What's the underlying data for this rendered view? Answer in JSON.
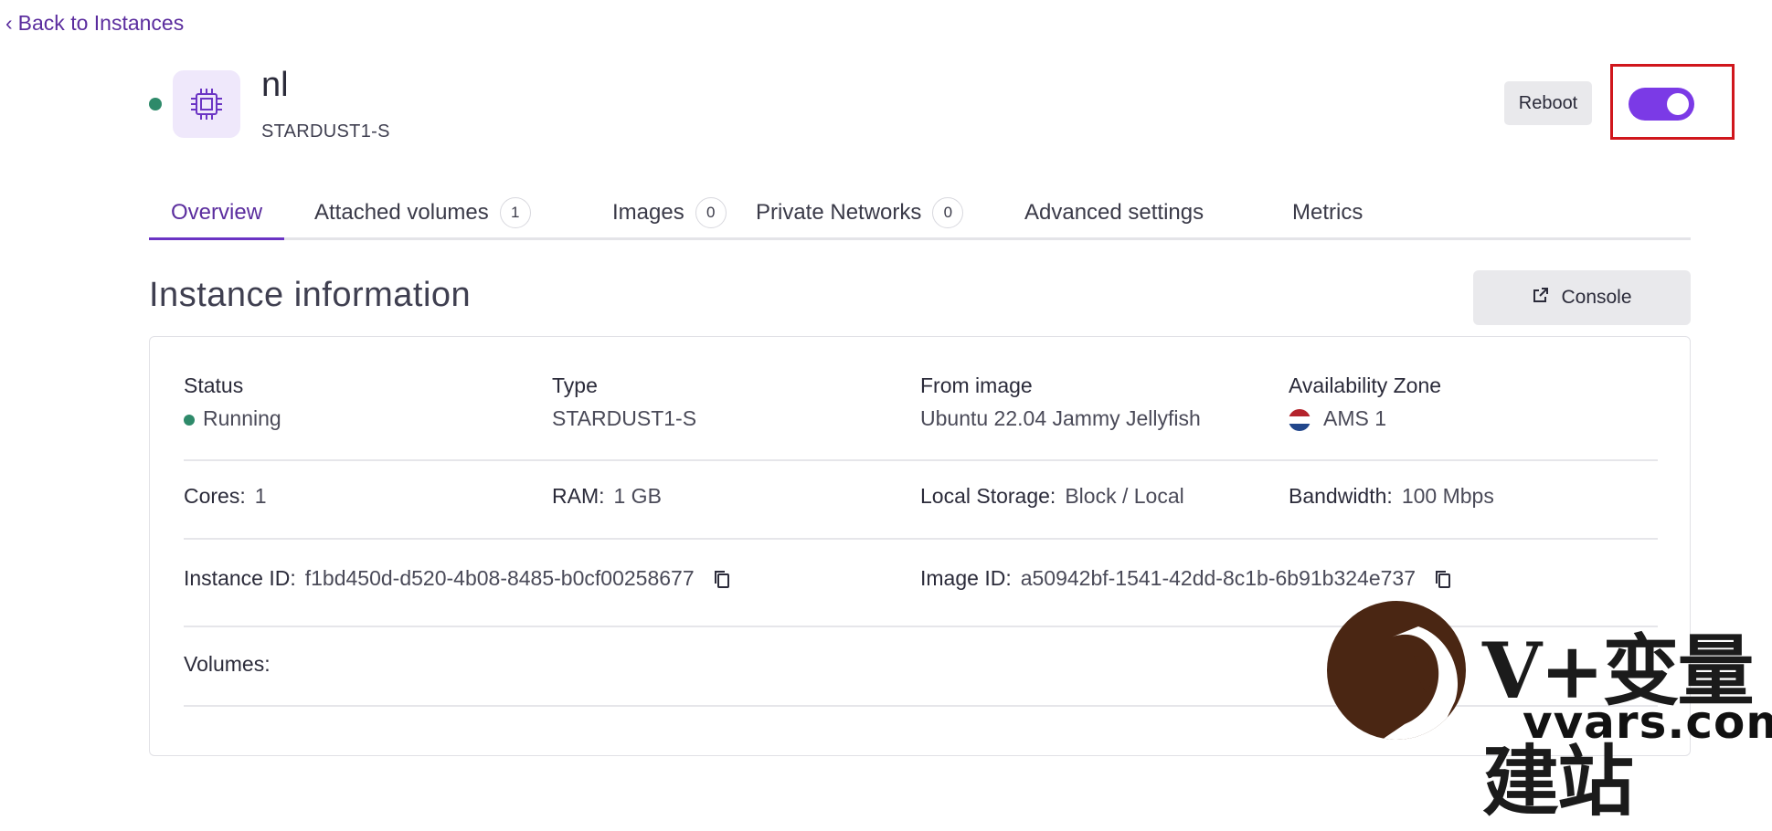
{
  "nav": {
    "back_label": "Back to Instances"
  },
  "instance": {
    "name": "nl",
    "type_label": "STARDUST1-S",
    "status_color": "#2e8a6a"
  },
  "actions": {
    "reboot_label": "Reboot",
    "power_toggle_on": true,
    "toggle_color": "#7b3ae6"
  },
  "tabs": [
    {
      "label": "Overview",
      "badge": ""
    },
    {
      "label": "Attached volumes",
      "badge": "1"
    },
    {
      "label": "Images",
      "badge": "0"
    },
    {
      "label": "Private Networks",
      "badge": "0"
    },
    {
      "label": "Advanced settings",
      "badge": ""
    },
    {
      "label": "Metrics",
      "badge": ""
    }
  ],
  "section": {
    "title": "Instance information",
    "console_label": "Console"
  },
  "info": {
    "status": {
      "label": "Status",
      "value": "Running"
    },
    "type": {
      "label": "Type",
      "value": "STARDUST1-S"
    },
    "image": {
      "label": "From image",
      "value": "Ubuntu 22.04 Jammy Jellyfish"
    },
    "zone": {
      "label": "Availability Zone",
      "value": "AMS 1"
    },
    "cores": {
      "label": "Cores:",
      "value": "1"
    },
    "ram": {
      "label": "RAM:",
      "value": "1 GB"
    },
    "storage": {
      "label": "Local Storage:",
      "value": "Block / Local"
    },
    "bandwidth": {
      "label": "Bandwidth:",
      "value": "100 Mbps"
    },
    "instance_id": {
      "label": "Instance ID:",
      "value": "f1bd450d-d520-4b08-8485-b0cf00258677"
    },
    "image_id": {
      "label": "Image ID:",
      "value": "a50942bf-1541-42dd-8c1b-6b91b324e737"
    },
    "volumes": {
      "label": "Volumes:"
    }
  },
  "watermark": {
    "text": "V+变量建站",
    "url": "vvars.com"
  }
}
